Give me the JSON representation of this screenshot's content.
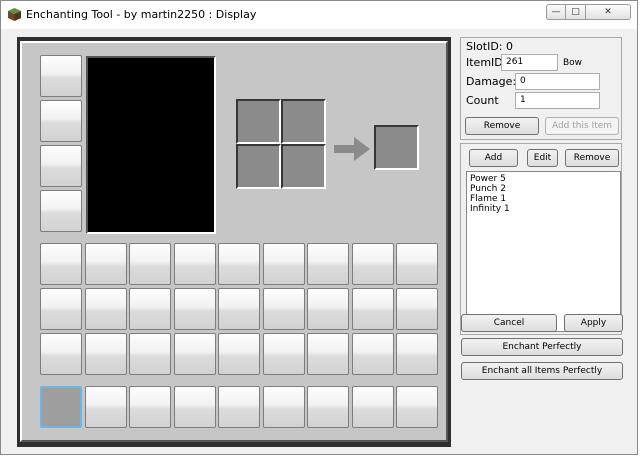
{
  "window": {
    "title": "Enchanting Tool - by martin2250 : Display",
    "controls": {
      "minimize": "—",
      "maximize": "□",
      "close": "✕"
    }
  },
  "item": {
    "slot_id_label": "SlotID: 0",
    "item_id_label": "ItemID:",
    "item_id_value": "261",
    "item_name": "Bow",
    "damage_label": "Damage:",
    "damage_value": "0",
    "count_label": "Count",
    "count_value": "1",
    "remove_button": "Remove",
    "add_item_button": "Add this Item"
  },
  "enchantments": {
    "add_button": "Add",
    "edit_button": "Edit",
    "remove_button": "Remove",
    "items": [
      "Power 5",
      "Punch 2",
      "Flame 1",
      "Infinity 1"
    ]
  },
  "actions": {
    "cancel": "Cancel",
    "apply": "Apply",
    "enchant_perfectly": "Enchant Perfectly",
    "enchant_all": "Enchant all Items Perfectly"
  },
  "inventory": {
    "armor_slots": 4,
    "main_rows": 3,
    "columns": 9,
    "hotbar_selected": 0
  }
}
